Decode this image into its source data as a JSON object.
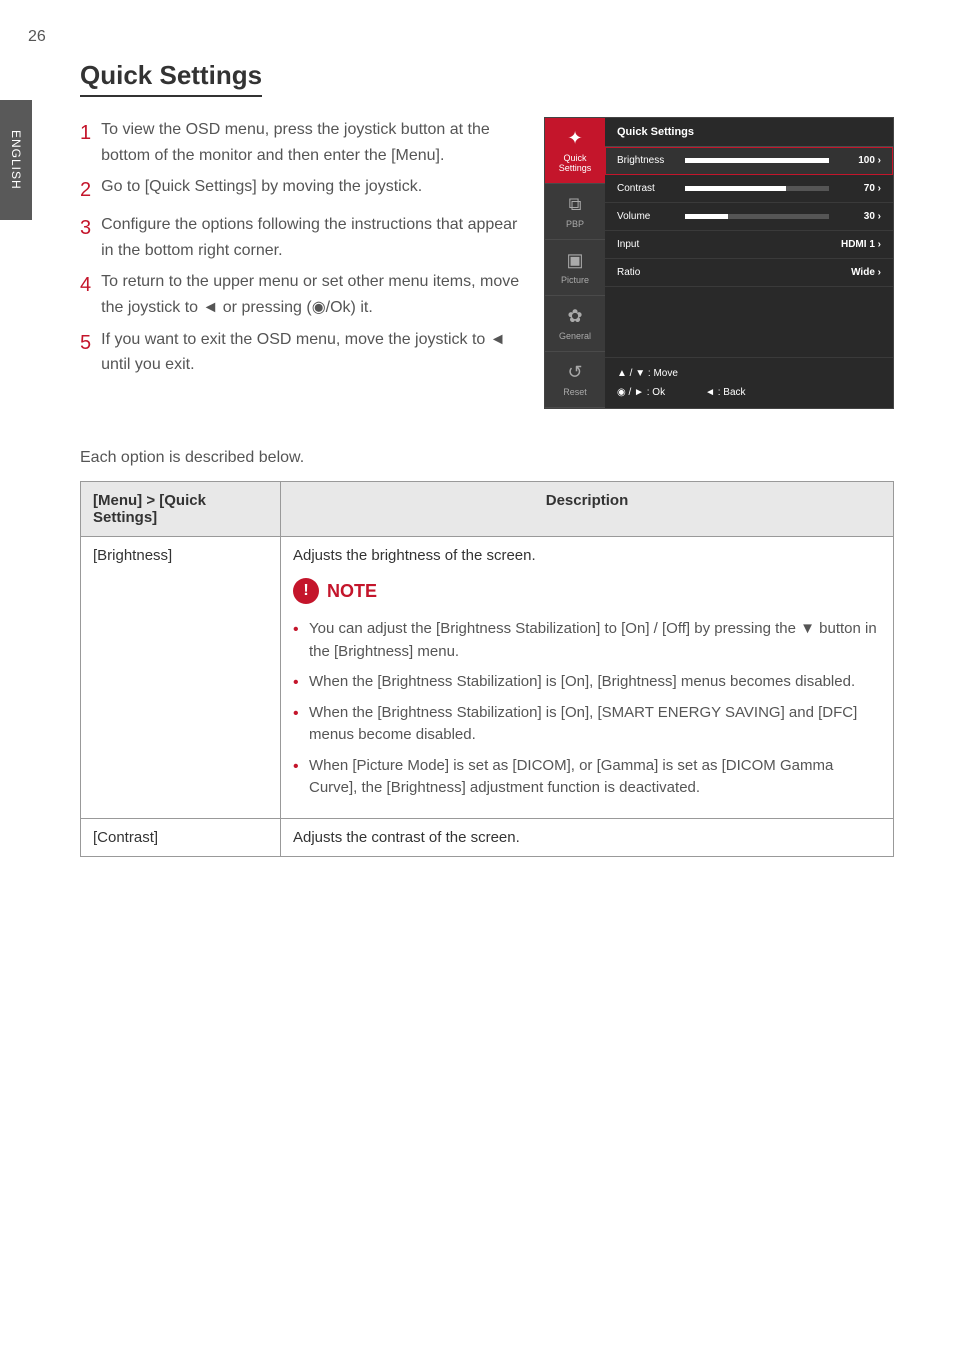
{
  "page_number": "26",
  "lang_tab": "ENGLISH",
  "section_title": "Quick Settings",
  "steps": [
    {
      "n": "1",
      "text": "To view the OSD menu, press the joystick button at the bottom of the monitor and then enter the [Menu]."
    },
    {
      "n": "2",
      "text": "Go to [Quick Settings] by moving the joystick."
    },
    {
      "n": "3",
      "text": "Configure the options following the instructions that appear in the bottom right corner."
    },
    {
      "n": "4",
      "text": "To return to the upper menu or set other menu items, move the joystick to ◄ or pressing (◉/Ok) it."
    },
    {
      "n": "5",
      "text": "If you want to exit the OSD menu, move the joystick to ◄ until you exit."
    }
  ],
  "osd": {
    "header": "Quick Settings",
    "sidebar": [
      {
        "icon": "✦",
        "label": "Quick Settings",
        "active": true
      },
      {
        "icon": "⧉",
        "label": "PBP",
        "active": false
      },
      {
        "icon": "▣",
        "label": "Picture",
        "active": false
      },
      {
        "icon": "✿",
        "label": "General",
        "active": false
      },
      {
        "icon": "↺",
        "label": "Reset",
        "active": false
      }
    ],
    "rows": [
      {
        "label": "Brightness",
        "value": "100",
        "fill": 100,
        "selected": true,
        "has_bar": true
      },
      {
        "label": "Contrast",
        "value": "70",
        "fill": 70,
        "selected": false,
        "has_bar": true
      },
      {
        "label": "Volume",
        "value": "30",
        "fill": 30,
        "selected": false,
        "has_bar": true
      },
      {
        "label": "Input",
        "value": "HDMI 1",
        "selected": false,
        "has_bar": false
      },
      {
        "label": "Ratio",
        "value": "Wide",
        "selected": false,
        "has_bar": false
      }
    ],
    "footer": {
      "move": "▲ / ▼ : Move",
      "ok": "◉ / ► : Ok",
      "back": "◄ : Back"
    }
  },
  "below_desc": "Each option is described below.",
  "table": {
    "head_left": "[Menu] > [Quick Settings]",
    "head_right": "Description",
    "rows": [
      {
        "name": "[Brightness]",
        "desc_intro": "Adjusts the brightness of the screen.",
        "note_label": "NOTE",
        "bullets": [
          "You can adjust the [Brightness Stabilization] to [On] / [Off] by pressing the ▼ button in the [Brightness] menu.",
          "When the [Brightness Stabilization] is [On], [Brightness] menus becomes disabled.",
          "When the [Brightness Stabilization] is [On], [SMART ENERGY SAVING] and [DFC] menus become disabled.",
          "When [Picture Mode] is set as [DICOM], or [Gamma] is set as [DICOM Gamma Curve], the [Brightness] adjustment function is deactivated."
        ]
      },
      {
        "name": "[Contrast]",
        "desc_intro": "Adjusts the contrast of the screen."
      }
    ]
  },
  "chart_data": {
    "type": "bar",
    "title": "Quick Settings OSD sliders",
    "categories": [
      "Brightness",
      "Contrast",
      "Volume"
    ],
    "values": [
      100,
      70,
      30
    ],
    "xlabel": "",
    "ylabel": "",
    "ylim": [
      0,
      100
    ]
  }
}
